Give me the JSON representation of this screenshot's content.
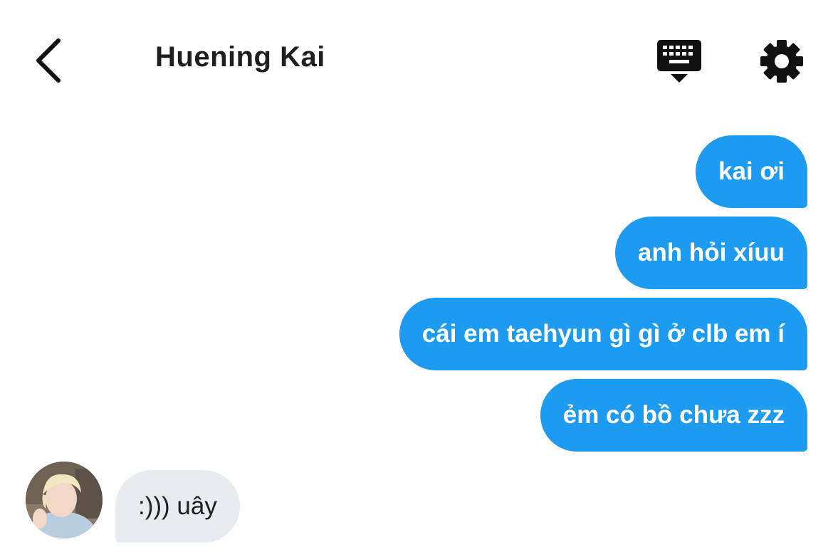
{
  "header": {
    "title": "Huening Kai",
    "back_icon": "chevron-left-icon",
    "keyboard_icon": "keyboard-icon",
    "settings_icon": "gear-icon"
  },
  "messages_out": [
    {
      "text": "kai ơi"
    },
    {
      "text": "anh hỏi xíuu"
    },
    {
      "text": "cái em taehyun gì gì ở clb em í"
    },
    {
      "text": "ẻm có bồ chưa zzz"
    }
  ],
  "message_in": {
    "text": ":))) uây",
    "avatar": "avatar"
  },
  "colors": {
    "accent": "#1d9bf0",
    "incoming_bubble": "#e8ecf0",
    "text_dark": "#1f1f1f"
  }
}
